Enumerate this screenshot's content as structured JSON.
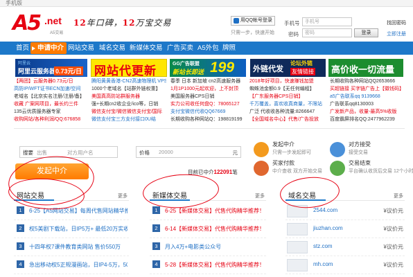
{
  "topbar": {
    "text": "手机版"
  },
  "header": {
    "logo_text": "A5",
    "logo_suffix": ".net",
    "logo_sub": "A5交易",
    "slogan_pre": "12",
    "slogan_mid": "年口碑，",
    "slogan_num": "12",
    "slogan_post": "万宝交易",
    "qq_login": "用QQ帐号登录",
    "quick_register": "只需一步，快速开始",
    "phone_label": "手机号",
    "phone_placeholder": "手机号",
    "password_label": "密码",
    "password_placeholder": "密码",
    "login_button": "登录",
    "find_password": "找回密码",
    "register": "立即注册"
  },
  "nav": {
    "items": [
      "首页",
      "申请中介",
      "网站交易",
      "域名交易",
      "新媒体交易",
      "广告买卖",
      "A5外包",
      "牌照"
    ]
  },
  "banners": {
    "b1_small": "阿里云",
    "b1_text": "阿里云服务器",
    "b1_price": "0.73元/日",
    "b2_text": "网站代更新",
    "b3_top": "GG广告联盟",
    "b3_mid": "新站长即送",
    "b3_num": "199",
    "b4_text": "外链代发",
    "b4_tag": "论坛外链",
    "b4_tag2": "友情链接",
    "b5_text": "高价收一切流量"
  },
  "ads": [
    [
      "【两团】云服务器0.73元/日",
      "腾阳黄黄香港-CN2高速物理机 VPS",
      "春季 日本 新加坡 cn2高速服务器",
      "2018年好项目，快速赚钱加盟",
      "长期收购各种网站QQ2653666"
    ],
    [
      "高防IP/WFT证书ECN加速/空间",
      "1000个老域名【站群外链权重】",
      "1月1P1000元起欢迎，上不封顶",
      "蜘蛛池金额0.9【无任何编程】",
      "买超链接 买字链广告上【徽钱码】"
    ],
    [
      "老域名【北京实名注册/注册/备】",
      "美国真高防站群服务器",
      "美国服务器CPS日销",
      "【广东服务器CPS日销】",
      "a5广告联系qq 9139668"
    ],
    [
      "收藏 广案网项目，最长约三件",
      "强+长期cn2收企业/ico等，日销",
      "实力公司收任何盘Q：78065127",
      "千万覆盖，喜欢收真商量，不限站",
      "广告联系qq8130003"
    ],
    [
      "135云优质服务器专家",
      "微信支付宝/微信微信支付宝/国际",
      "支付宝微信代收QQ67669",
      "广泛 代收收各种流量:8266647",
      "广发新产品，收量-最高5%收版"
    ],
    [
      "收购网站/各种利润/QQ:676858",
      "微信支付宝三方支付接口0U结",
      "长期收购各种网站Q：198819199",
      "【全国域名中心】代售/广告投放",
      "百度霸屏排名QQ:2477962239"
    ]
  ],
  "search": {
    "keyword_label": "搜要",
    "select_label": "出售",
    "keyword_placeholder": "对方用户名",
    "price_label": "价格",
    "price_value": "20000",
    "unit": "元",
    "launch_button": "发起中介",
    "count_prefix": "目前已中介",
    "count_value": "122091",
    "count_suffix": "笔"
  },
  "steps": [
    {
      "title": "发起中介",
      "desc": "只需一步发起即可",
      "color": "#f39a1e"
    },
    {
      "title": "对方接受",
      "desc": "接受交易",
      "color": "#4a90d9"
    },
    {
      "title": "买家付款",
      "desc": "中介查收 双方开始交易",
      "color": "#e0672f"
    },
    {
      "title": "交易结束",
      "desc": "平台确认收货后交易 12个小时内一次支付",
      "color": "#5cae4b"
    }
  ],
  "columns": {
    "website": {
      "title": "网站交易",
      "more": "更多",
      "items": [
        {
          "n": "1",
          "text": "6-25【A5网站交易】每周代售网站精华推",
          "color": "#1e6fc4"
        },
        {
          "n": "2",
          "text": "权5美剧下载站，日IP5万+ 最低20万实收",
          "color": "#1e6fc4"
        },
        {
          "n": "3",
          "text": "十四年权7课件教育类网站 售价550万",
          "color": "#1e6fc4"
        },
        {
          "n": "4",
          "text": "急出移动权5正规漫画站，日IP4-5万，50",
          "color": "#1e6fc4"
        }
      ]
    },
    "media": {
      "title": "新媒体交易",
      "more": "更多",
      "items": [
        {
          "n": "1",
          "text": "6-25【新媒体交易】代售代购精华推荐！",
          "color": "#e60012"
        },
        {
          "n": "2",
          "text": "6-14【新媒体交易】代售代购精华推荐！",
          "color": "#e60012"
        },
        {
          "n": "3",
          "text": "月入4万+电影类公众号",
          "color": "#1e6fc4"
        },
        {
          "n": "4",
          "text": "5-28【新媒体交易】代售代购精华推荐！",
          "color": "#e60012"
        }
      ]
    },
    "domain": {
      "title": "域名交易",
      "more": "更多",
      "items": [
        {
          "domain": "2544.com",
          "price": "¥议价元"
        },
        {
          "domain": "jiuzhan.com",
          "price": "¥议价元"
        },
        {
          "domain": "stz.com",
          "price": "¥议价元"
        },
        {
          "domain": "mh.com",
          "price": "¥议价元"
        }
      ]
    }
  },
  "colors": {
    "brand_red": "#e60012",
    "nav_blue": "#1d78c9",
    "accent_orange": "#ff7b00",
    "annotation_red": "#e60012"
  }
}
